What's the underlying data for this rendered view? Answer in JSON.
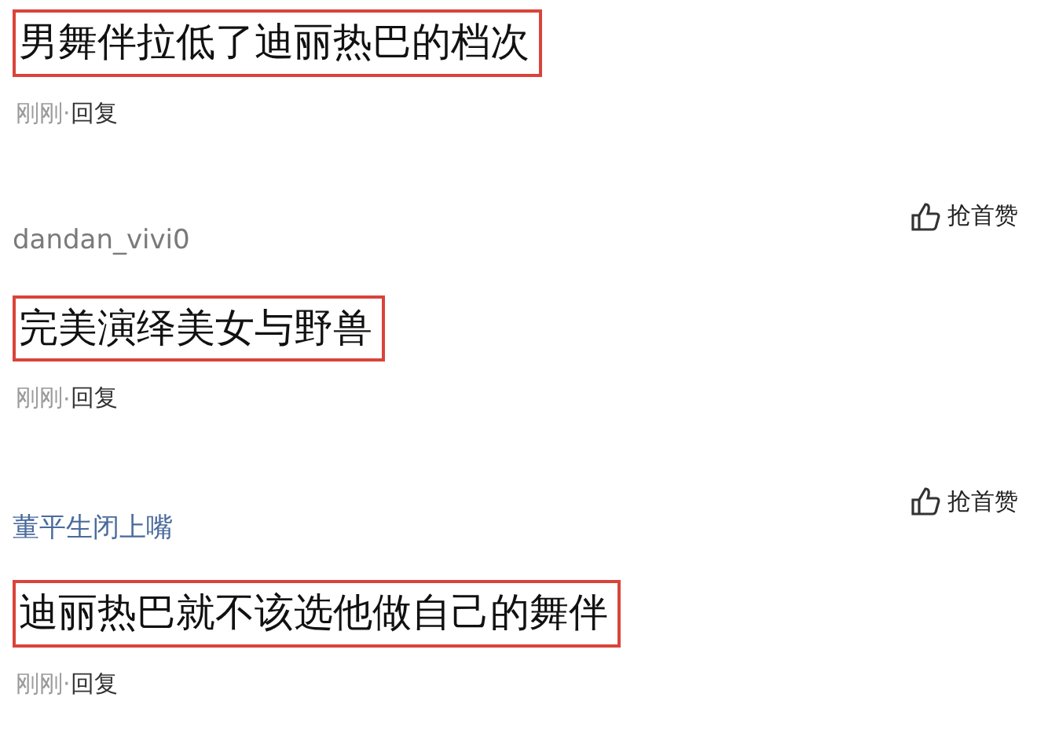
{
  "comments": [
    {
      "text": "男舞伴拉低了迪丽热巴的档次",
      "highlighted": true,
      "time": "刚刚",
      "separator": "·",
      "reply": "回复"
    },
    {
      "username": "dandan_vivi0",
      "color": "#7a7a7a",
      "like": "抢首赞",
      "text": "完美演绎美女与野兽",
      "highlighted": true,
      "time": "刚刚",
      "separator": "·",
      "reply": "回复"
    },
    {
      "username": "董平生闭上嘴",
      "color": "#4a6a9c",
      "like": "抢首赞",
      "text": "迪丽热巴就不该选他做自己的舞伴",
      "highlighted": true,
      "time": "刚刚",
      "separator": "·",
      "reply": "回复"
    }
  ]
}
